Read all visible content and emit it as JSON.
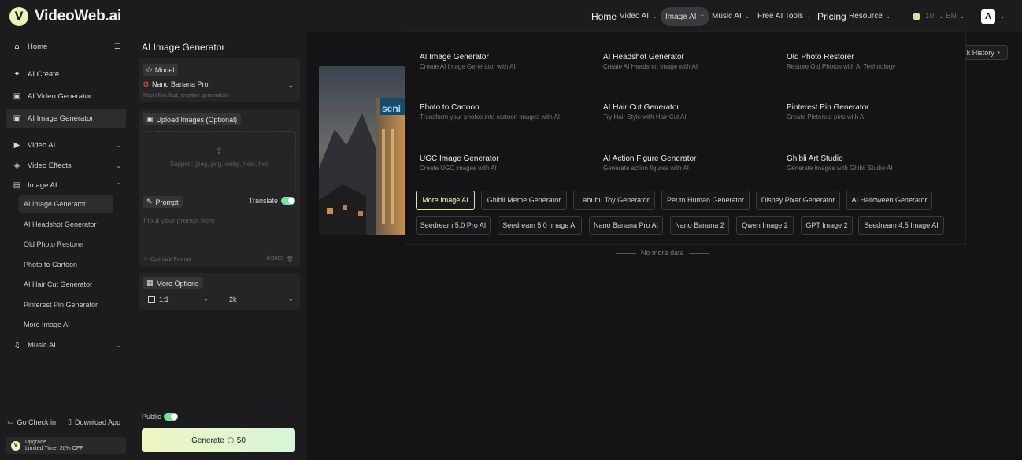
{
  "brand": {
    "name": "VideoWeb.ai"
  },
  "nav": {
    "home": "Home",
    "video_ai": "Video AI",
    "image_ai": "Image AI",
    "music_ai": "Music AI",
    "free_tools": "Free AI Tools",
    "pricing": "Pricing",
    "resource": "Resource",
    "credits": "10",
    "lang": "EN",
    "avatar": "A"
  },
  "sidebar": {
    "home": "Home",
    "ai_create": "AI Create",
    "ai_video_generator": "AI Video Generator",
    "ai_image_generator": "AI Image Generator",
    "video_ai": "Video AI",
    "video_effects": "Video Effects",
    "image_ai": "Image AI",
    "image_sub": [
      "AI Image Generator",
      "AI Headshot Generator",
      "Old Photo Restorer",
      "Photo to Cartoon",
      "AI Hair Cut Generator",
      "Pinterest Pin Generator",
      "More Image AI"
    ],
    "music_ai": "Music AI",
    "check_in": "Go Check in",
    "download_app": "Download App",
    "upgrade_title": "Upgrade",
    "upgrade_sub": "Limited Time: 20% OFF"
  },
  "generator": {
    "title": "AI Image Generator",
    "model_label": "Model",
    "model_name": "Nano Banana Pro",
    "model_desc": "Max Ultra-fast, creative generation",
    "upload_label": "Upload Images (Optional)",
    "upload_hint": "Support: jpeg, png, webp, heic, heif",
    "prompt_label": "Prompt",
    "translate_label": "Translate",
    "prompt_placeholder": "Input your prompt here",
    "optimize_label": "Optimize Prompt",
    "char_count": "0/3000",
    "more_options": "More Options",
    "ratio": "1:1",
    "resolution": "2k",
    "public_label": "Public",
    "generate_label": "Generate",
    "generate_cost": "50"
  },
  "main": {
    "history_label": "k History",
    "no_more": "No more data",
    "thumb_sign": "seni"
  },
  "dropdown": {
    "items": [
      {
        "title": "AI Image Generator",
        "desc": "Create AI Image Generator with AI"
      },
      {
        "title": "AI Headshot Generator",
        "desc": "Create AI Headshot Image with AI"
      },
      {
        "title": "Old Photo Restorer",
        "desc": "Restore Old Photos with AI Technology"
      },
      {
        "title": "Photo to Cartoon",
        "desc": "Transform your photos into cartoon images with AI"
      },
      {
        "title": "AI Hair Cut Generator",
        "desc": "Try Hair Style with Hair Cut AI"
      },
      {
        "title": "Pinterest Pin Generator",
        "desc": "Create Pinterest pins with AI"
      },
      {
        "title": "UGC Image Generator",
        "desc": "Create UGC images with AI"
      },
      {
        "title": "AI Action Figure Generator",
        "desc": "Generate action figures with AI"
      },
      {
        "title": "Ghibli Art Studio",
        "desc": "Generate images with Ghibli Studio AI"
      }
    ],
    "tags": [
      "More Image AI",
      "Ghibli Meme Generator",
      "Labubu Toy Generator",
      "Pet to Human Generator",
      "Disney Pixar Generator",
      "AI Halloween Generator",
      "Seedream 5.0 Pro AI",
      "Seedream 5.0 Image AI",
      "Nano Banana Pro AI",
      "Nano Banana 2",
      "Qwen Image 2",
      "GPT Image 2",
      "Seedream 4.5 Image AI"
    ]
  },
  "colors": {
    "accent": "#e9f5b8",
    "toggle": "#7be0a0",
    "background": "#1a1a1c"
  }
}
